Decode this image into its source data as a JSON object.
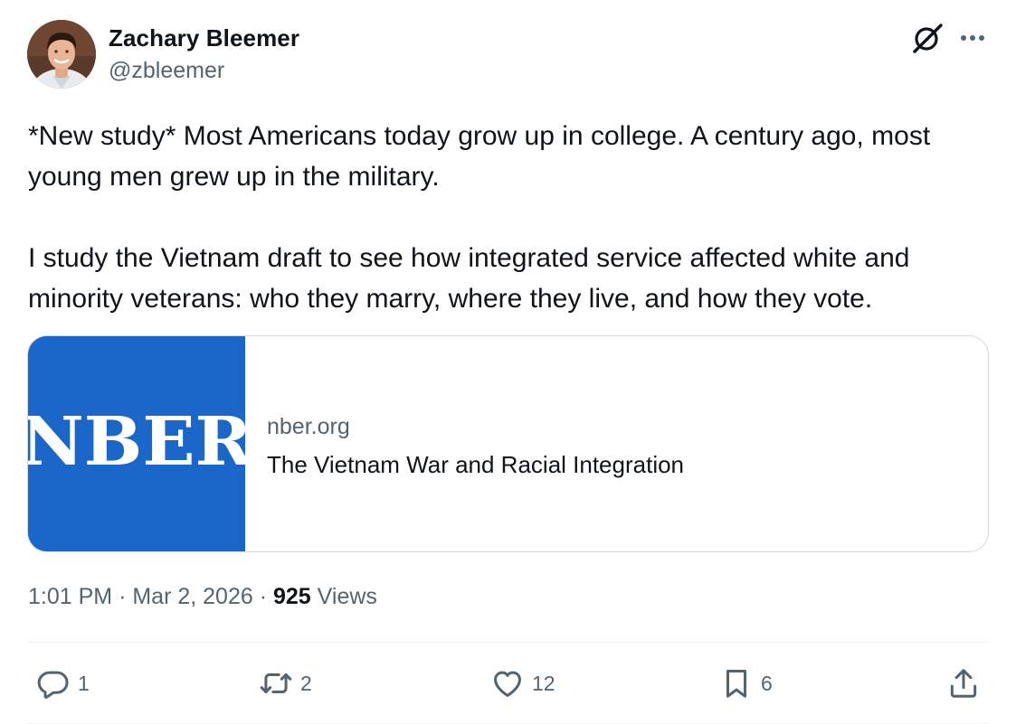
{
  "author": {
    "display_name": "Zachary Bleemer",
    "handle": "@zbleemer"
  },
  "tweet": {
    "paragraphs": [
      "*New study* Most Americans today grow up in college. A century ago, most young men grew up in the military.",
      "I study the Vietnam draft to see how integrated service affected white and minority veterans: who they marry, where they live, and how they vote."
    ]
  },
  "card": {
    "image_text": "NBER",
    "domain": "nber.org",
    "title": "The Vietnam War and Racial Integration"
  },
  "meta": {
    "time": "1:01 PM",
    "separator": "·",
    "date": "Mar 2, 2026",
    "views_count": "925",
    "views_label": "Views"
  },
  "actions": {
    "replies": "1",
    "reposts": "2",
    "likes": "12",
    "bookmarks": "6"
  },
  "icons": {
    "grok": "grok-icon",
    "more": "more-horizontal-icon",
    "reply": "reply-icon",
    "repost": "repost-icon",
    "like": "heart-icon",
    "bookmark": "bookmark-icon",
    "share": "share-icon"
  },
  "colors": {
    "text": "#0f1419",
    "secondary": "#536471",
    "border": "#cfd9de",
    "nber_blue": "#1b66c9"
  }
}
